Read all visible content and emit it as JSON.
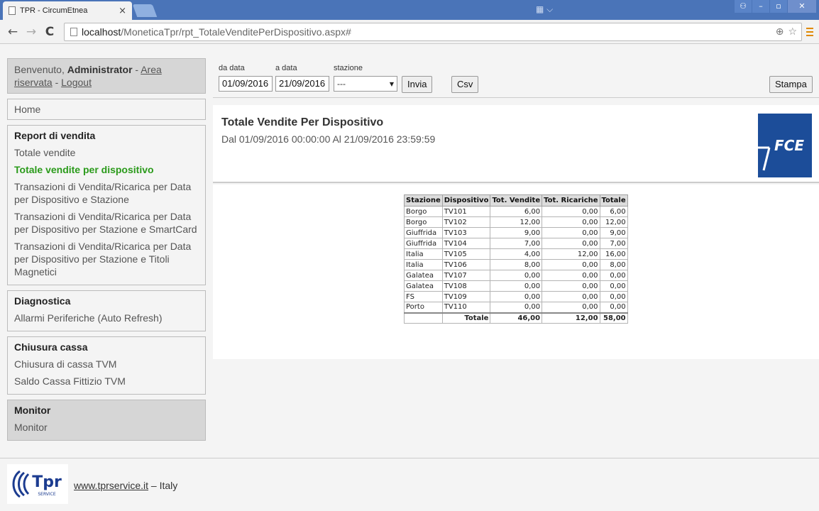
{
  "browser": {
    "tab_title": "TPR - CircumEtnea",
    "tab_close": "×",
    "url_host": "localhost",
    "url_path": "/MoneticaTpr/rpt_TotaleVenditePerDispositivo.aspx#",
    "back": "←",
    "forward": "→",
    "reload": "C",
    "zoom": "⊕",
    "star": "☆"
  },
  "sidebar": {
    "welcome_prefix": "Benvenuto,",
    "user": "Administrator",
    "area_link": "Area riservata",
    "logout_link": "Logout",
    "home": "Home",
    "sections": [
      {
        "title": "Report di vendita",
        "items": [
          "Totale vendite",
          "Totale vendite per dispositivo",
          "Transazioni di Vendita/Ricarica per Data per Dispositivo e Stazione",
          "Transazioni di Vendita/Ricarica per Data per Dispositivo per Stazione e SmartCard",
          "Transazioni di Vendita/Ricarica per Data per Dispositivo per Stazione e Titoli Magnetici"
        ]
      },
      {
        "title": "Diagnostica",
        "items": [
          "Allarmi Periferiche (Auto Refresh)"
        ]
      },
      {
        "title": "Chiusura cassa",
        "items": [
          "Chiusura di cassa TVM",
          "Saldo Cassa Fittizio TVM"
        ]
      },
      {
        "title": "Monitor",
        "items": [
          "Monitor"
        ]
      }
    ]
  },
  "filters": {
    "from_label": "da data",
    "from_value": "01/09/2016",
    "to_label": "a data",
    "to_value": "21/09/2016",
    "station_label": "stazione",
    "station_value": "---",
    "send": "Invia",
    "csv": "Csv",
    "print": "Stampa"
  },
  "report": {
    "title": "Totale Vendite Per Dispositivo",
    "subtitle": "Dal 01/09/2016 00:00:00 Al 21/09/2016 23:59:59",
    "logo_text": "FCE",
    "columns": [
      "Stazione",
      "Dispositivo",
      "Tot. Vendite",
      "Tot. Ricariche",
      "Totale"
    ],
    "rows": [
      [
        "Borgo",
        "TV101",
        "6,00",
        "0,00",
        "6,00"
      ],
      [
        "Borgo",
        "TV102",
        "12,00",
        "0,00",
        "12,00"
      ],
      [
        "Giuffrida",
        "TV103",
        "9,00",
        "0,00",
        "9,00"
      ],
      [
        "Giuffrida",
        "TV104",
        "7,00",
        "0,00",
        "7,00"
      ],
      [
        "Italia",
        "TV105",
        "4,00",
        "12,00",
        "16,00"
      ],
      [
        "Italia",
        "TV106",
        "8,00",
        "0,00",
        "8,00"
      ],
      [
        "Galatea",
        "TV107",
        "0,00",
        "0,00",
        "0,00"
      ],
      [
        "Galatea",
        "TV108",
        "0,00",
        "0,00",
        "0,00"
      ],
      [
        "FS",
        "TV109",
        "0,00",
        "0,00",
        "0,00"
      ],
      [
        "Porto",
        "TV110",
        "0,00",
        "0,00",
        "0,00"
      ]
    ],
    "total_row": [
      "",
      "Totale",
      "46,00",
      "12,00",
      "58,00"
    ]
  },
  "footer": {
    "link": "www.tprservice.it",
    "suffix": " – Italy",
    "logo_text": "Tpr",
    "logo_sub": "SERVICE"
  },
  "colors": {
    "titlebar": "#4a74b8",
    "active_link": "#2a9a1a",
    "fce_blue": "#1c4d99"
  }
}
